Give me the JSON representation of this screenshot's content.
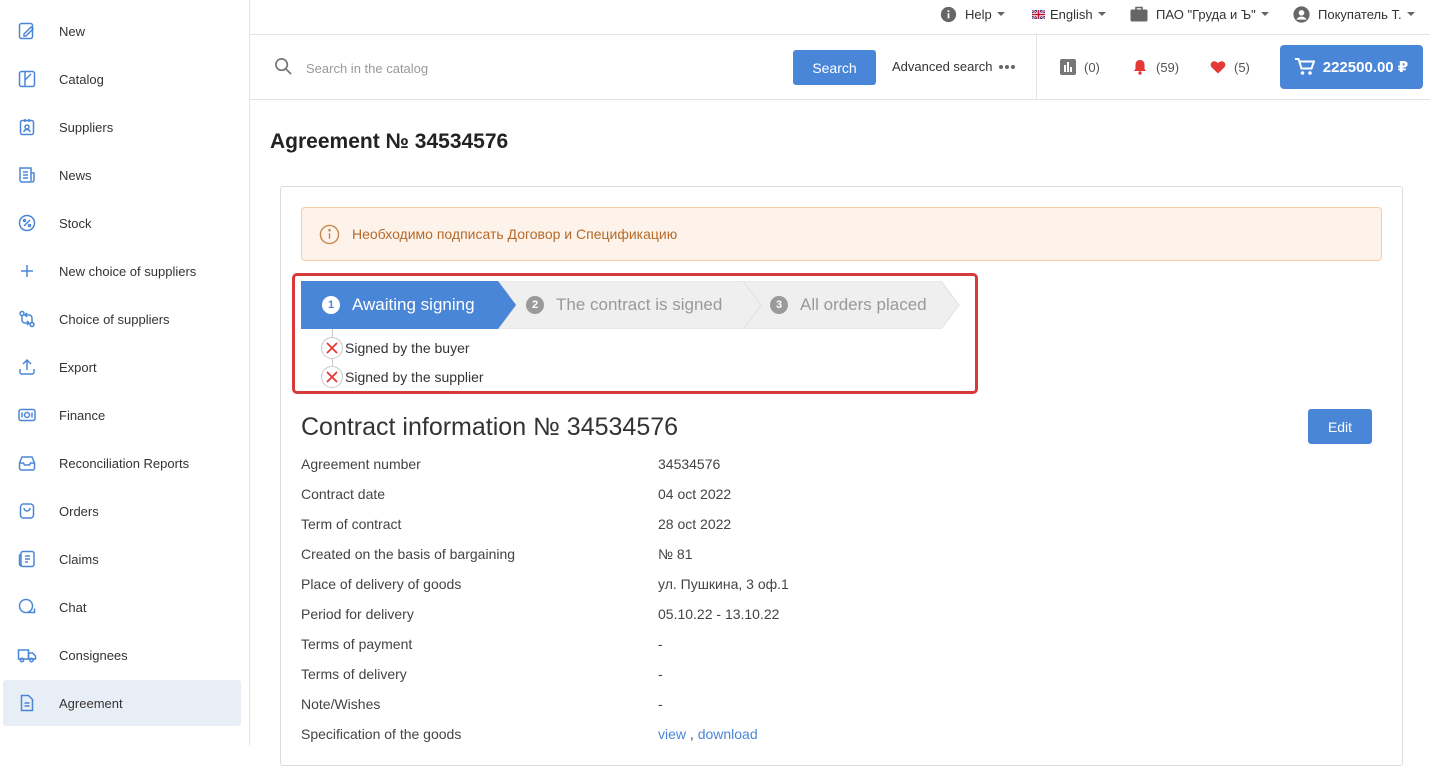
{
  "sidebar": {
    "items": [
      {
        "label": "New",
        "icon": "new-icon"
      },
      {
        "label": "Catalog",
        "icon": "catalog-icon"
      },
      {
        "label": "Suppliers",
        "icon": "suppliers-icon"
      },
      {
        "label": "News",
        "icon": "news-icon"
      },
      {
        "label": "Stock",
        "icon": "percent-icon"
      },
      {
        "label": "New choice of suppliers",
        "icon": "plus-icon"
      },
      {
        "label": "Choice of suppliers",
        "icon": "swap-icon"
      },
      {
        "label": "Export",
        "icon": "upload-icon"
      },
      {
        "label": "Finance",
        "icon": "money-icon"
      },
      {
        "label": "Reconciliation Reports",
        "icon": "inbox-icon"
      },
      {
        "label": "Orders",
        "icon": "bag-icon"
      },
      {
        "label": "Claims",
        "icon": "claims-icon"
      },
      {
        "label": "Chat",
        "icon": "chat-icon"
      },
      {
        "label": "Consignees",
        "icon": "truck-icon"
      },
      {
        "label": "Agreement",
        "icon": "document-icon"
      }
    ],
    "active": "Agreement"
  },
  "topbar": {
    "help": "Help",
    "language": "English",
    "company": "ПАО \"Груда и Ъ\"",
    "user": "Покупатель Т."
  },
  "search": {
    "placeholder": "Search in the catalog",
    "button": "Search",
    "advanced": "Advanced search"
  },
  "counters": {
    "compare": "(0)",
    "notifications": "(59)",
    "favorites": "(5)"
  },
  "cart": {
    "total": "222500.00 ₽"
  },
  "page": {
    "title": "Agreement № 34534576"
  },
  "alert": {
    "text": "Необходимо подписать Договор и Спецификацию"
  },
  "steps": [
    {
      "num": "1",
      "label": "Awaiting signing",
      "state": "active"
    },
    {
      "num": "2",
      "label": "The contract is signed",
      "state": "inactive"
    },
    {
      "num": "3",
      "label": "All orders placed",
      "state": "inactive"
    }
  ],
  "substatus": [
    {
      "label": "Signed by the buyer",
      "signed": false
    },
    {
      "label": "Signed by the supplier",
      "signed": false
    }
  ],
  "contract": {
    "title": "Contract information № 34534576",
    "edit": "Edit",
    "rows": [
      {
        "key": "Agreement number",
        "value": "34534576"
      },
      {
        "key": "Contract date",
        "value": "04 oct 2022"
      },
      {
        "key": "Term of contract",
        "value": "28 oct 2022"
      },
      {
        "key": "Created on the basis of bargaining",
        "value": "№ 81"
      },
      {
        "key": "Place of delivery of goods",
        "value": "ул. Пушкина, 3 оф.1"
      },
      {
        "key": "Period for delivery",
        "value": "05.10.22 - 13.10.22"
      },
      {
        "key": "Terms of payment",
        "value": "-"
      },
      {
        "key": "Terms of delivery",
        "value": "-"
      },
      {
        "key": "Note/Wishes",
        "value": "-"
      },
      {
        "key": "Specification of the goods",
        "view": "view",
        "sep": ",",
        "download": "download"
      }
    ]
  },
  "colors": {
    "accent": "#4a86d8",
    "highlight": "#d63a3a",
    "alert_bg": "#fdf3ea",
    "alert_text": "#b56a2a",
    "notification": "#e53935",
    "favorite": "#e53935"
  }
}
